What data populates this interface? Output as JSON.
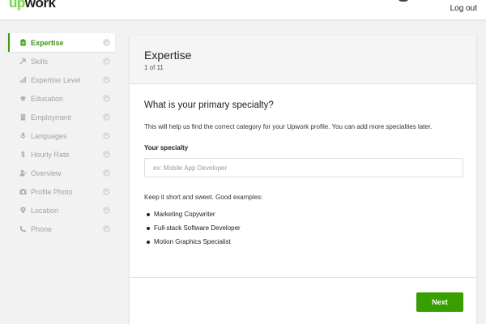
{
  "header": {
    "logo_prefix": "up",
    "logo_suffix": "work",
    "logout_label": "Log out"
  },
  "sidebar": {
    "items": [
      {
        "label": "Expertise",
        "icon": "clipboard-icon",
        "active": true
      },
      {
        "label": "Skills",
        "icon": "tools-icon",
        "active": false
      },
      {
        "label": "Expertise Level",
        "icon": "bar-chart-icon",
        "active": false
      },
      {
        "label": "Education",
        "icon": "graduation-cap-icon",
        "active": false
      },
      {
        "label": "Employment",
        "icon": "building-icon",
        "active": false
      },
      {
        "label": "Languages",
        "icon": "microphone-icon",
        "active": false
      },
      {
        "label": "Hourly Rate",
        "icon": "dollar-icon",
        "active": false
      },
      {
        "label": "Overview",
        "icon": "person-icon",
        "active": false
      },
      {
        "label": "Profile Photo",
        "icon": "camera-icon",
        "active": false
      },
      {
        "label": "Location",
        "icon": "map-pin-icon",
        "active": false
      },
      {
        "label": "Phone",
        "icon": "phone-icon",
        "active": false
      }
    ]
  },
  "card": {
    "title": "Expertise",
    "step": "1 of 11",
    "question": "What is your primary specialty?",
    "description": "This will help us find the correct category for your Upwork profile. You can add more specialties later.",
    "specialty_label": "Your specialty",
    "specialty_placeholder": "ex: Mobile App Developer",
    "specialty_value": "",
    "hint": "Keep it short and sweet. Good examples:",
    "examples": [
      "Marketing Copywriter",
      "Full-stack Software Developer",
      "Motion Graphics Specialist"
    ],
    "next_label": "Next"
  },
  "colors": {
    "accent": "#37a000",
    "logo_green": "#6fda44"
  }
}
